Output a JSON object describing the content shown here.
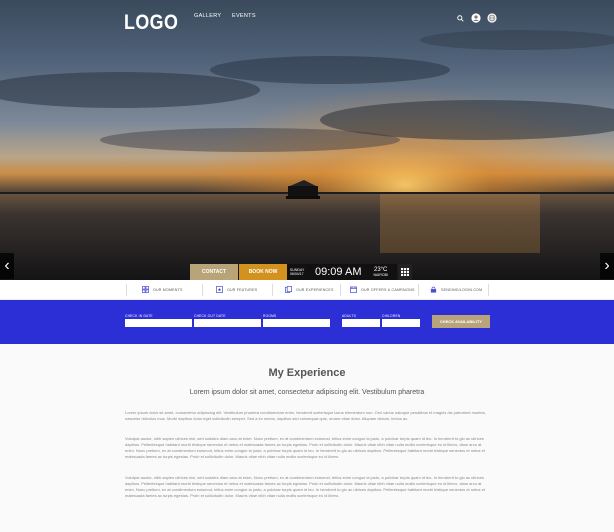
{
  "header": {
    "logo": "LOGO",
    "nav": [
      "GALLERY",
      "EVENTS"
    ],
    "icons": [
      "search-icon",
      "user-icon",
      "globe-icon"
    ]
  },
  "booking": {
    "contact_label": "CONTACT",
    "book_label": "BOOK NOW",
    "date_line1": "SUNDAY",
    "date_line2": "06/04/17",
    "time": "09:09 AM",
    "weather_temp": "23°C",
    "weather_place": "NAIROBI"
  },
  "features": [
    {
      "label": "OUR MOMENTS",
      "icon": "grid-icon"
    },
    {
      "label": "OUR FEATURES",
      "icon": "star-icon"
    },
    {
      "label": "OUR EXPERIENCES",
      "icon": "copy-icon"
    },
    {
      "label": "OUR OFFERS & CAMPAIGNS",
      "icon": "calendar-icon"
    },
    {
      "label": "SENDING/LOGIN.COM",
      "icon": "lock-icon"
    }
  ],
  "search": {
    "check_in": "CHECK IN DATE",
    "check_out": "CHECK OUT DATE",
    "rooms": "ROOMS",
    "adults": "ADULTS",
    "children": "CHILDREN",
    "button": "CHECK AVAILABILITY"
  },
  "content": {
    "title": "My Experience",
    "subtitle": "Lorem ipsum dolor sit amet, consectetur adipiscing elit. Vestibulum pharetra",
    "paragraphs": [
      "Lorem ipsum dolor sit amet, consectetur adipiscing elit. Vestibulum pharetra condimentum enim, hendrerit scelerisque lacus elementum non. Orci varius natoque penatibus et magnis dis parturient montes, nascetur ridiculus mus. Morbi dapibus dolor eget sollicitudin semper. Sed a ex metus, dapibus sed consequat quis, ornare vitae dolor. Aliquam dictum, lectus ac.",
      "Volutpat auctor, nibh sapien ultrices nisl, sed sodales diam arcu at enim. Nunc pretium, ex at condimentum euismod, tellus enim congue la justo, a pulvinar turpis quam id leo. In hendrerit to glo ac ultrices dapibus. Pellentesque habitant morbi tristique senectus et netus et malesuada fames ac turpis egestas. Proin et sollicitudin dolor. Mauris vitae nibh vitae nulla mollis scelerisque eu id libero, diam arcu at enim. Nunc pretium, ex at condimentum euismod, tellus enim congue la justo, a pulvinar turpis quam id leo. In hendrerit to glo ac ultrices dapibus. Pellentesque habitant morbi tristique senectus et netus et malesuada fames ac turpis egestas. Proin et sollicitudin dolor. Mauris vitae nibh vitae nulla mollis scelerisque eu id libero.",
      "Volutpat auctor, nibh sapien ultrices nisl, sed sodales diam arcu at enim. Nunc pretium, ex at condimentum euismod, tellus enim congue la justo, a pulvinar turpis quam id leo. In hendrerit to glo ac ultrices dapibus. Pellentesque habitant morbi tristique senectus et netus et malesuada fames ac turpis egestas. Proin et sollicitudin dolor. Mauris vitae nibh vitae nulla mollis scelerisque eu id libero, diam arcu at enim. Nunc pretium, ex at condimentum euismod, tellus enim congue la justo, a pulvinar turpis quam id leo. In hendrerit to glo ac ultrices dapibus. Pellentesque habitant morbi tristique senectus et netus et malesuada fames ac turpis egestas. Proin et sollicitudin dolor. Mauris vitae nibh vitae nulla mollis scelerisque eu id libero."
    ]
  },
  "colors": {
    "accent_blue": "#2d2fd6",
    "gold": "#b9a47a",
    "orange": "#d3911e"
  }
}
